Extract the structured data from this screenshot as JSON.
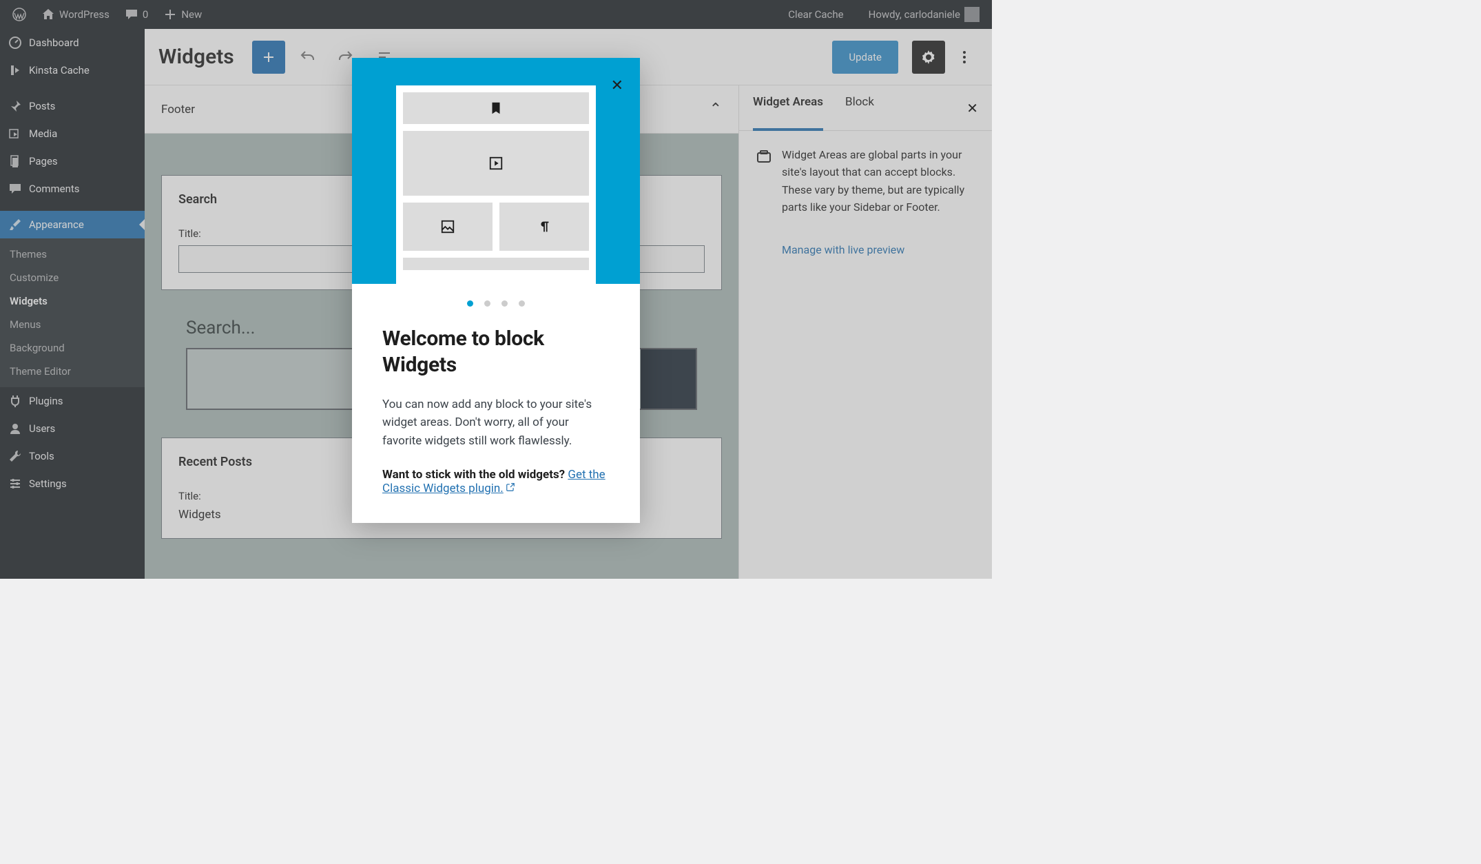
{
  "adminbar": {
    "site": "WordPress",
    "comments": "0",
    "new": "New",
    "clear_cache": "Clear Cache",
    "howdy": "Howdy, carlodaniele"
  },
  "sidebar": {
    "items": [
      {
        "label": "Dashboard"
      },
      {
        "label": "Kinsta Cache"
      },
      {
        "label": "Posts"
      },
      {
        "label": "Media"
      },
      {
        "label": "Pages"
      },
      {
        "label": "Comments"
      },
      {
        "label": "Appearance",
        "active": true
      },
      {
        "label": "Plugins"
      },
      {
        "label": "Users"
      },
      {
        "label": "Tools"
      },
      {
        "label": "Settings"
      }
    ],
    "submenu": [
      {
        "label": "Themes"
      },
      {
        "label": "Customize"
      },
      {
        "label": "Widgets",
        "current": true
      },
      {
        "label": "Menus"
      },
      {
        "label": "Background"
      },
      {
        "label": "Theme Editor"
      }
    ]
  },
  "editor": {
    "title": "Widgets",
    "update": "Update"
  },
  "canvas": {
    "area_title": "Footer",
    "search_widget": {
      "heading": "Search",
      "title_label": "Title:",
      "title_value": "",
      "preview_label": "Search..."
    },
    "recent_widget": {
      "heading": "Recent Posts",
      "title_label": "Title:",
      "title_value": "Widgets"
    }
  },
  "right_panel": {
    "tabs": [
      "Widget Areas",
      "Block"
    ],
    "desc": "Widget Areas are global parts in your site's layout that can accept blocks. These vary by theme, but are typically parts like your Sidebar or Footer.",
    "link": "Manage with live preview"
  },
  "modal": {
    "heading": "Welcome to block Widgets",
    "body": "You can now add any block to your site's widget areas. Don't worry, all of your favorite widgets still work flawlessly.",
    "stick_prefix": "Want to stick with the old widgets? ",
    "stick_link": "Get the Classic Widgets plugin."
  }
}
